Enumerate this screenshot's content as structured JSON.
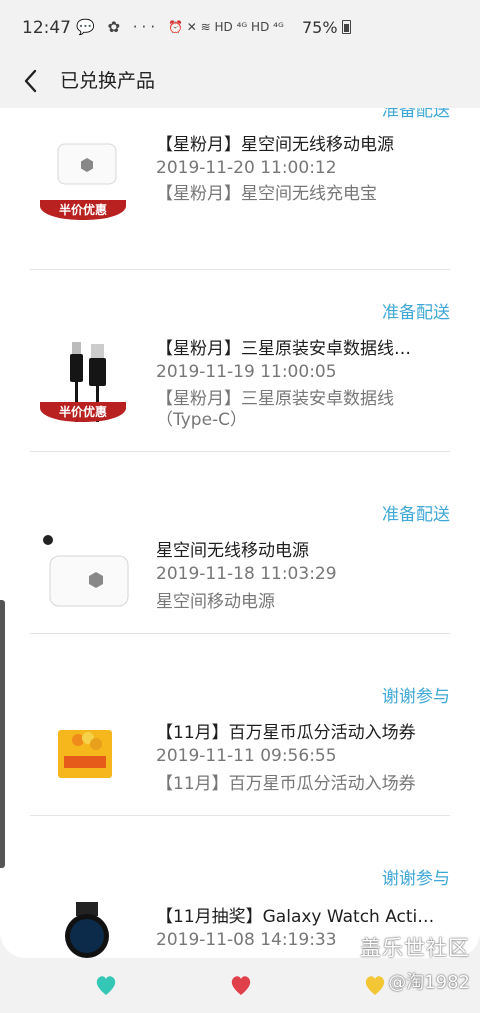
{
  "status_bar": {
    "time": "12:47",
    "left_icons": "💬 ✿ ···",
    "right_icons": "⏰ ✕ ≋ HD ⁴ᴳ HD ⁴ᴳ",
    "battery": "75%"
  },
  "header": {
    "title": "已兑换产品"
  },
  "items": [
    {
      "status": "准备配送",
      "name": "【星粉月】星空间无线移动电源",
      "date": "2019-11-20 11:00:12",
      "desc": "【星粉月】星空间无线充电宝",
      "badge": "半价优惠",
      "icon": "power-bank"
    },
    {
      "status": "准备配送",
      "name": "【星粉月】三星原装安卓数据线…",
      "date": "2019-11-19 11:00:05",
      "desc": "【星粉月】三星原装安卓数据线（Type-C）",
      "badge": "半价优惠",
      "icon": "usb-cable"
    },
    {
      "status": "准备配送",
      "name": "星空间无线移动电源",
      "date": "2019-11-18 11:03:29",
      "desc": "星空间移动电源",
      "icon": "power-bank"
    },
    {
      "status": "谢谢参与",
      "name": "【11月】百万星币瓜分活动入场券",
      "date": "2019-11-11 09:56:55",
      "desc": "【11月】百万星币瓜分活动入场券",
      "icon": "ticket"
    },
    {
      "status": "谢谢参与",
      "name": "【11月抽奖】Galaxy Watch Acti…",
      "date": "2019-11-08 14:19:33",
      "desc": "",
      "icon": "watch"
    }
  ],
  "watermark": {
    "line1": "盖乐世社区",
    "line2": "@淘1982"
  },
  "colors": {
    "accent": "#3fa8d6",
    "badge": "#b92020"
  }
}
